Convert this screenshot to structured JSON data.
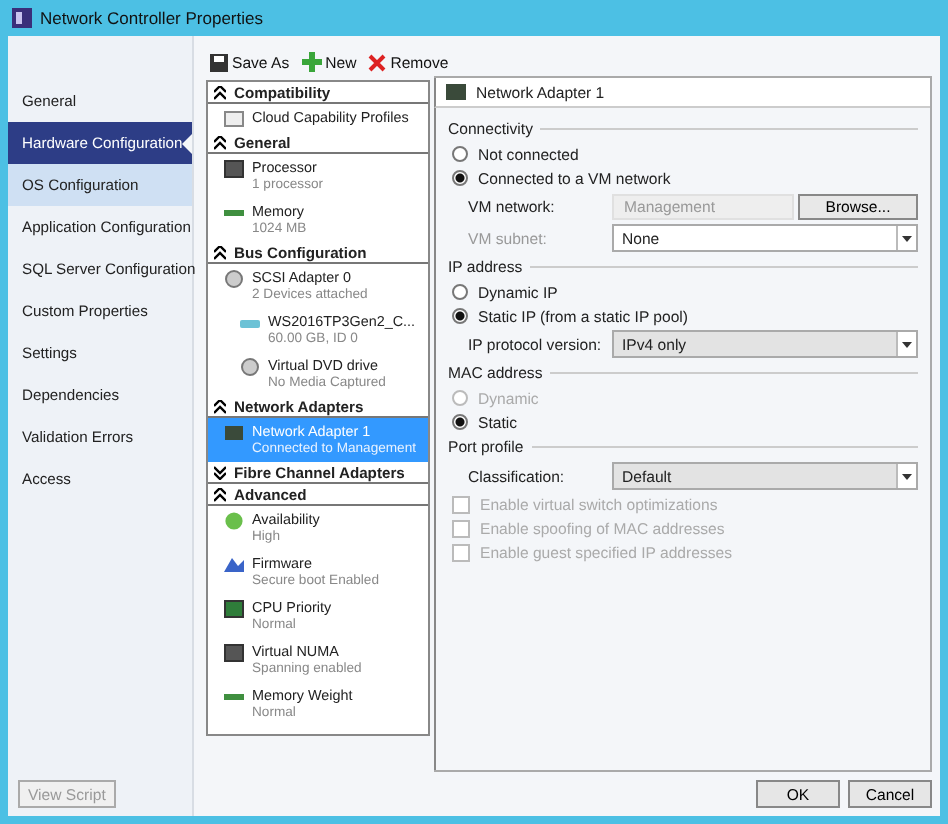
{
  "window": {
    "title": "Network Controller Properties"
  },
  "sidebar": {
    "items": [
      {
        "label": "General",
        "selected": false,
        "hovered": false
      },
      {
        "label": "Hardware Configuration",
        "selected": true,
        "hovered": false
      },
      {
        "label": "OS Configuration",
        "selected": false,
        "hovered": true
      },
      {
        "label": "Application Configuration",
        "selected": false,
        "hovered": false
      },
      {
        "label": "SQL Server Configuration",
        "selected": false,
        "hovered": false
      },
      {
        "label": "Custom Properties",
        "selected": false,
        "hovered": false
      },
      {
        "label": "Settings",
        "selected": false,
        "hovered": false
      },
      {
        "label": "Dependencies",
        "selected": false,
        "hovered": false
      },
      {
        "label": "Validation Errors",
        "selected": false,
        "hovered": false
      },
      {
        "label": "Access",
        "selected": false,
        "hovered": false
      }
    ]
  },
  "toolbar": [
    {
      "label": "Save As",
      "kind": "save",
      "disabled": false
    },
    {
      "label": "New",
      "kind": "new",
      "disabled": false
    },
    {
      "label": "Remove",
      "kind": "remove",
      "disabled": false
    }
  ],
  "tree": [
    {
      "kind": "section",
      "label": "Compatibility",
      "expanded": true
    },
    {
      "kind": "item",
      "label": "Cloud Capability Profiles",
      "selected": false,
      "indent": false
    },
    {
      "kind": "section",
      "label": "General",
      "expanded": true
    },
    {
      "kind": "item",
      "label": "Processor",
      "detail": "1 processor",
      "selected": false,
      "indent": false
    },
    {
      "kind": "item",
      "label": "Memory",
      "detail": "1024 MB",
      "selected": false,
      "indent": false
    },
    {
      "kind": "section",
      "label": "Bus Configuration",
      "expanded": true
    },
    {
      "kind": "item",
      "label": "SCSI Adapter 0",
      "detail": "2 Devices attached",
      "selected": false,
      "indent": false
    },
    {
      "kind": "item",
      "label": "WS2016TP3Gen2_C...",
      "detail": "60.00 GB, ID 0",
      "selected": false,
      "indent": true
    },
    {
      "kind": "item",
      "label": "Virtual DVD drive",
      "detail": "No Media Captured",
      "selected": false,
      "indent": true
    },
    {
      "kind": "section",
      "label": "Network Adapters",
      "expanded": true
    },
    {
      "kind": "item",
      "label": "Network Adapter 1",
      "detail": "Connected to Management",
      "selected": true,
      "indent": false
    },
    {
      "kind": "section",
      "label": "Fibre Channel Adapters",
      "expanded": false
    },
    {
      "kind": "section",
      "label": "Advanced",
      "expanded": true
    },
    {
      "kind": "item",
      "label": "Availability",
      "detail": "High",
      "selected": false,
      "indent": false
    },
    {
      "kind": "item",
      "label": "Firmware",
      "detail": "Secure boot Enabled",
      "selected": false,
      "indent": false
    },
    {
      "kind": "item",
      "label": "CPU Priority",
      "detail": "Normal",
      "selected": false,
      "indent": false
    },
    {
      "kind": "item",
      "label": "Virtual NUMA",
      "detail": "Spanning enabled",
      "selected": false,
      "indent": false
    },
    {
      "kind": "item",
      "label": "Memory Weight",
      "detail": "Normal",
      "selected": false,
      "indent": false
    }
  ],
  "panel": {
    "title": "Network Adapter 1",
    "rows": [
      {
        "kind": "group",
        "label": "Connectivity"
      },
      {
        "kind": "radio",
        "label": "Not connected",
        "selected": false,
        "disabled": false
      },
      {
        "kind": "radio",
        "label": "Connected to a VM network",
        "selected": true,
        "disabled": false
      },
      {
        "kind": "field",
        "label": "VM network:",
        "value": "Management",
        "button": "Browse...",
        "disabled": true
      },
      {
        "kind": "select",
        "label": "VM subnet:",
        "value": "None",
        "disabled": true,
        "filled": false
      },
      {
        "kind": "group",
        "label": "IP address"
      },
      {
        "kind": "radio",
        "label": "Dynamic IP",
        "selected": false,
        "disabled": false
      },
      {
        "kind": "radio",
        "label": "Static IP (from a static IP pool)",
        "selected": true,
        "disabled": false
      },
      {
        "kind": "select",
        "label": "IP protocol version:",
        "value": "IPv4 only",
        "disabled": false,
        "filled": true
      },
      {
        "kind": "group",
        "label": "MAC address"
      },
      {
        "kind": "radio",
        "label": "Dynamic",
        "selected": false,
        "disabled": true
      },
      {
        "kind": "radio",
        "label": "Static",
        "selected": true,
        "disabled": false
      },
      {
        "kind": "group",
        "label": "Port profile"
      },
      {
        "kind": "select",
        "label": "Classification:",
        "value": "Default",
        "disabled": false,
        "filled": true
      },
      {
        "kind": "checkbox",
        "label": "Enable virtual switch optimizations",
        "checked": false,
        "disabled": true
      },
      {
        "kind": "checkbox",
        "label": "Enable spoofing of MAC addresses",
        "checked": false,
        "disabled": true
      },
      {
        "kind": "checkbox",
        "label": "Enable guest specified IP addresses",
        "checked": false,
        "disabled": true
      }
    ]
  },
  "footer": {
    "script_button": "View Script",
    "script_disabled": true,
    "buttons": [
      "OK",
      "Cancel"
    ]
  }
}
